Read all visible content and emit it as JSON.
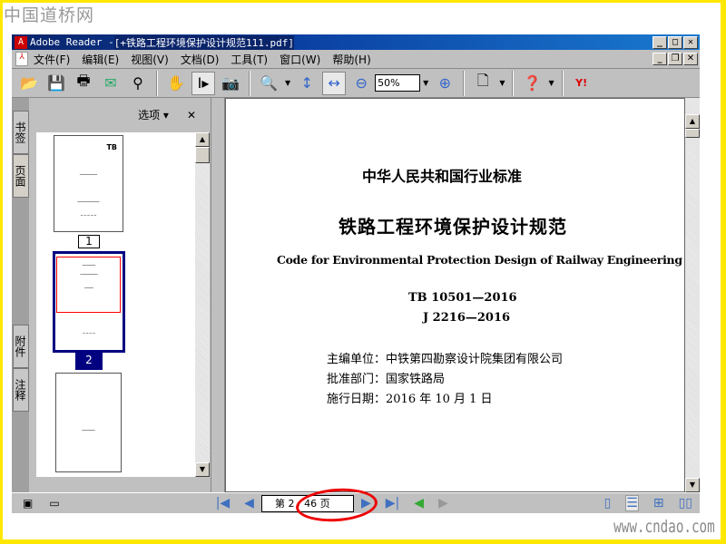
{
  "watermark_top": "中国道桥网",
  "watermark_bottom": "www.cndao.com",
  "window": {
    "title_app": "Adobe Reader - ",
    "title_file": "[+铁路工程环境保护设计规范111.pdf]"
  },
  "menu": [
    "文件(F)",
    "编辑(E)",
    "视图(V)",
    "文档(D)",
    "工具(T)",
    "窗口(W)",
    "帮助(H)"
  ],
  "toolbar": {
    "zoom": "50%"
  },
  "side_tabs": [
    "书签",
    "页面",
    "附件",
    "注释"
  ],
  "panel": {
    "options": "选项 ▾",
    "close": "✕",
    "page_labels": [
      "1",
      "2"
    ],
    "selected_page": 2
  },
  "document": {
    "line1": "中华人民共和国行业标准",
    "title": "铁路工程环境保护设计规范",
    "title_en": "Code for Environmental Protection Design of Railway Engineering",
    "code1": "TB 10501—2016",
    "code2": "J 2216—2016",
    "info": [
      "主编单位：中铁第四勘察设计院集团有限公司",
      "批准部门：国家铁路局",
      "施行日期：2016 年 10 月 1 日"
    ]
  },
  "status": {
    "page_display": "第 2 / 46 页",
    "current_page": 2,
    "total_pages": 46
  }
}
